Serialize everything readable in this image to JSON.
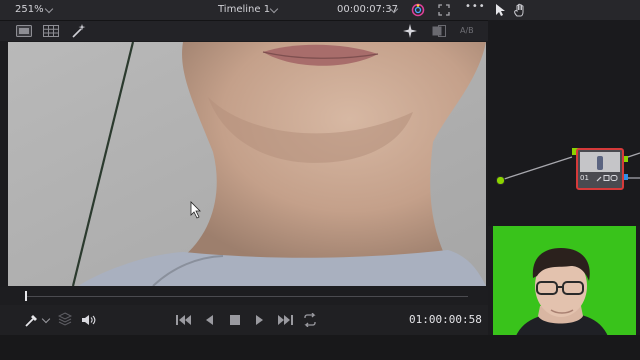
{
  "topbar": {
    "zoom": "251%",
    "timeline_name": "Timeline 1",
    "source_timecode": "00:00:07:37",
    "more_label": "•••"
  },
  "toolbar": {
    "ab_label": "A/B"
  },
  "transport": {
    "timecode": "01:00:00:58"
  },
  "nodes": {
    "node_label": "01"
  },
  "colors": {
    "background": "#1c1c1f",
    "panel": "#27272b",
    "accent_green": "#8bd400",
    "node_border": "#d63a3a",
    "chroma_green": "#39c31b"
  },
  "icons": [
    "chevron-down-icon",
    "color-wheel-icon",
    "fullscreen-icon",
    "pointer-icon",
    "hand-icon",
    "single-viewer-icon",
    "grid-icon",
    "magic-wand-icon",
    "sparkle-icon",
    "compare-icon",
    "eyedropper-icon",
    "layers-icon",
    "volume-icon",
    "skip-back-icon",
    "play-reverse-icon",
    "stop-icon",
    "play-icon",
    "skip-forward-icon",
    "loop-icon"
  ]
}
